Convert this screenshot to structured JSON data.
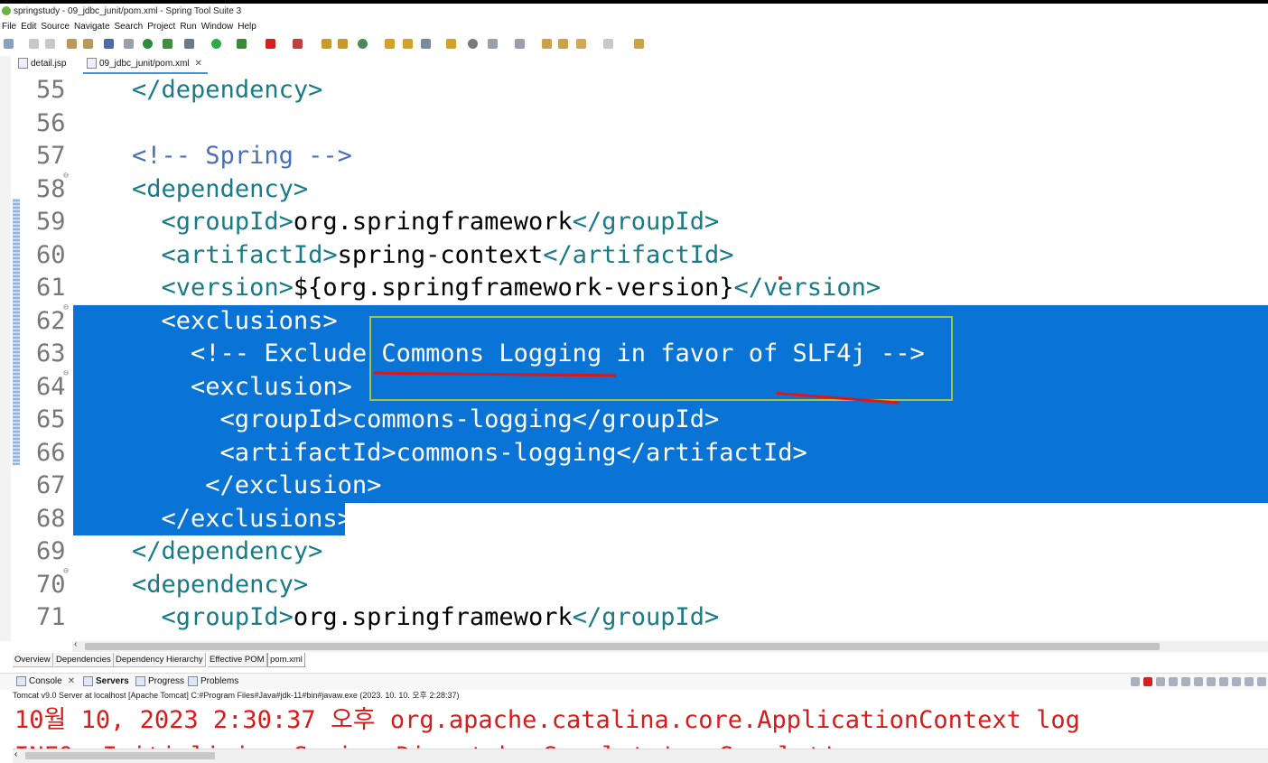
{
  "window": {
    "title": "springstudy - 09_jdbc_junit/pom.xml - Spring Tool Suite 3"
  },
  "menu": [
    "File",
    "Edit",
    "Source",
    "Navigate",
    "Search",
    "Project",
    "Run",
    "Window",
    "Help"
  ],
  "editor_tabs": [
    {
      "label": "detail.jsp",
      "active": false
    },
    {
      "label": "09_jdbc_junit/pom.xml",
      "active": true
    }
  ],
  "code_lines": [
    {
      "num": "55",
      "text": "    </dependency>"
    },
    {
      "num": "56",
      "text": ""
    },
    {
      "num": "57",
      "text": "    <!-- Spring -->"
    },
    {
      "num": "58",
      "text": "    <dependency>"
    },
    {
      "num": "59",
      "text": "      <groupId>org.springframework</groupId>"
    },
    {
      "num": "60",
      "text": "      <artifactId>spring-context</artifactId>"
    },
    {
      "num": "61",
      "text": "      <version>${org.springframework-version}</version>"
    },
    {
      "num": "62",
      "text": "      <exclusions>"
    },
    {
      "num": "63",
      "text": "        <!-- Exclude Commons Logging in favor of SLF4j -->"
    },
    {
      "num": "64",
      "text": "        <exclusion>"
    },
    {
      "num": "65",
      "text": "          <groupId>commons-logging</groupId>"
    },
    {
      "num": "66",
      "text": "          <artifactId>commons-logging</artifactId>"
    },
    {
      "num": "67",
      "text": "         </exclusion>"
    },
    {
      "num": "68",
      "text": "      </exclusions>"
    },
    {
      "num": "69",
      "text": "    </dependency>"
    },
    {
      "num": "70",
      "text": "    <dependency>"
    },
    {
      "num": "71",
      "text": "      <groupId>org.springframework</groupId>"
    }
  ],
  "pom_tabs": [
    "Overview",
    "Dependencies",
    "Dependency Hierarchy",
    "Effective POM",
    "pom.xml"
  ],
  "console_tabs": [
    "Console",
    "Servers",
    "Progress",
    "Problems"
  ],
  "console": {
    "status": "Tomcat v9.0 Server at localhost [Apache Tomcat] C:#Program Files#Java#jdk-11#bin#javaw.exe  (2023. 10. 10. 오후 2:28:37)",
    "line1": "10월 10, 2023 2:30:37 오후 org.apache.catalina.core.ApplicationContext log",
    "line2": "INFO: Initializing Spring DispatcherServlet 'appServlet'"
  },
  "colors": {
    "selection": "#0a74d6",
    "tag": "#187b86",
    "comment": "#4a6fb5",
    "annotation_box": "#a9c23f",
    "annotation_line": "#e01515",
    "console_text": "#d81b1b"
  }
}
